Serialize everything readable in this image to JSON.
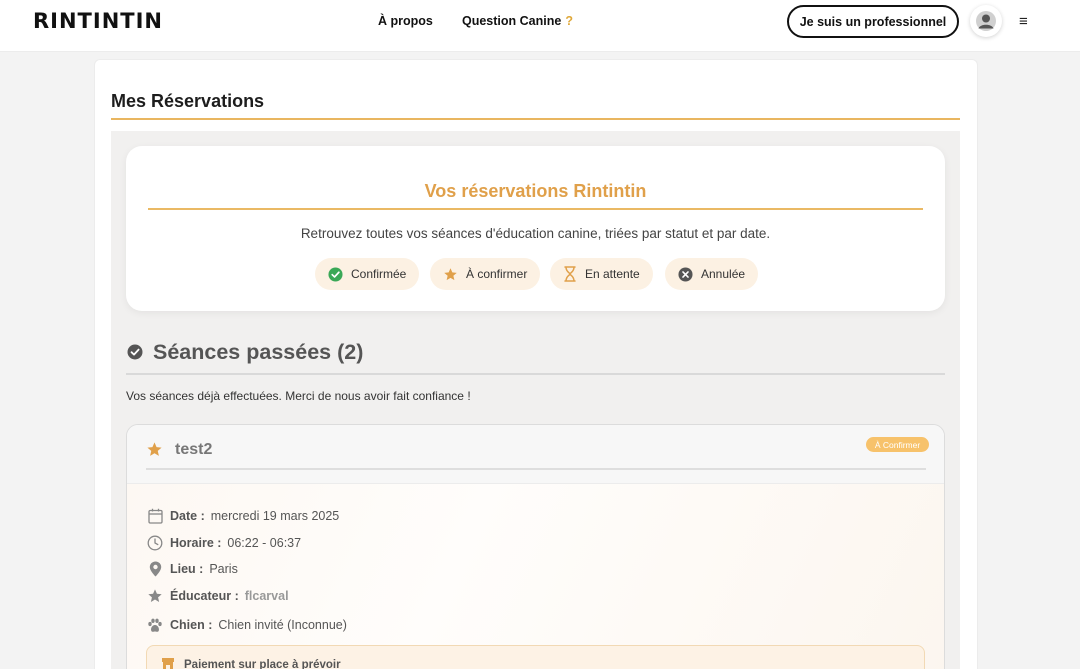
{
  "header": {
    "logo": "RINTINTIN",
    "nav": {
      "about": "À propos",
      "question": "Question Canine",
      "question_mark": "?"
    },
    "pro_button": "Je suis un professionnel",
    "menu_icon": "≡"
  },
  "page": {
    "title": "Mes Réservations"
  },
  "intro": {
    "title": "Vos réservations Rintintin",
    "text": "Retrouvez toutes vos séances d'éducation canine, triées par statut et par date.",
    "legend": [
      {
        "label": "Confirmée",
        "icon": "check-circle-icon",
        "color": "#3aa857"
      },
      {
        "label": "À confirmer",
        "icon": "star-icon",
        "color": "#e0a04a"
      },
      {
        "label": "En attente",
        "icon": "hourglass-icon",
        "color": "#e0a04a"
      },
      {
        "label": "Annulée",
        "icon": "x-circle-icon",
        "color": "#555555"
      }
    ]
  },
  "section": {
    "title": "Séances passées (2)",
    "description": "Vos séances déjà effectuées. Merci de nous avoir fait confiance !"
  },
  "reservation": {
    "name": "test2",
    "status": "À Confirmer",
    "date_label": "Date :",
    "date_value": "mercredi 19 mars 2025",
    "time_label": "Horaire :",
    "time_value": "06:22 - 06:37",
    "place_label": "Lieu :",
    "place_value": "Paris",
    "educator_label": "Éducateur :",
    "educator_value": "flcarval",
    "dog_label": "Chien :",
    "dog_value": "Chien invité (Inconnue)",
    "payment_text": "Paiement sur place à prévoir"
  },
  "colors": {
    "accent": "#e0a04a",
    "confirmed": "#3aa857",
    "badge": "#f7c26b"
  }
}
